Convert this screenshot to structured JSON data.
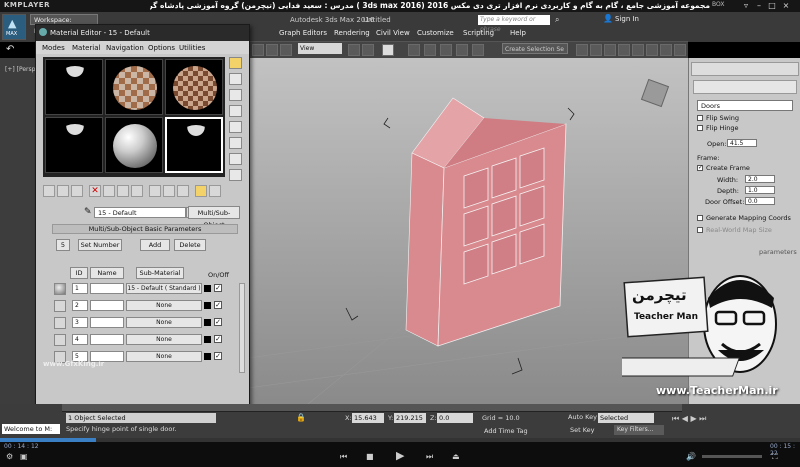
{
  "player": {
    "logo": "KMPLAYER",
    "title": "مجموعه آموزشی جامع ، گام به گام و کاربردی نرم افزار تری دی مکس 2016 (3ds max 2016 ) مدرس : سعید فدایی (تیچرمن) گروه آموزشی پادشاه گرافیست ها",
    "box_label": "BOX",
    "time_current": "00 : 14 : 12",
    "time_total": "00 : 15 : 22",
    "progress": 0.12
  },
  "max": {
    "logo_label": "MAX",
    "workspace": "Workspace: Default",
    "app_title": "Autodesk 3ds Max 2016",
    "file_title": "Untitled",
    "search_placeholder": "Type a keyword or phrase",
    "sign_in": "Sign In",
    "menus": [
      "Graph Editors",
      "Rendering",
      "Civil View",
      "Customize",
      "Scripting",
      "Help"
    ],
    "view_dropdown": "View",
    "selection_set": "Create Selection Se",
    "viewport_label": "[+] [Perspective] [Realistic]"
  },
  "material_editor": {
    "title": "Material Editor - 15 - Default",
    "menus": [
      "Modes",
      "Material",
      "Navigation",
      "Options",
      "Utilities"
    ],
    "material_name": "15 - Default",
    "material_type": "Multi/Sub-Object",
    "rollout_title": "Multi/Sub-Object Basic Parameters",
    "num_value": "5",
    "set_number": "Set Number",
    "add": "Add",
    "delete": "Delete",
    "col_id": "ID",
    "col_name": "Name",
    "col_submaterial": "Sub-Material",
    "col_onoff": "On/Off",
    "rows": [
      {
        "id": "1",
        "material": "15 - Default  ( Standard )"
      },
      {
        "id": "2",
        "material": "None"
      },
      {
        "id": "3",
        "material": "None"
      },
      {
        "id": "4",
        "material": "None"
      },
      {
        "id": "5",
        "material": "None"
      }
    ]
  },
  "command_panel": {
    "object_type": "Doors",
    "flip_swing": "Flip Swing",
    "flip_hinge": "Flip Hinge",
    "open_label": "Open:",
    "open_value": "41.5",
    "frame_label": "Frame:",
    "create_frame": "Create Frame",
    "width_label": "Width:",
    "width_value": "2.0",
    "depth_label": "Depth:",
    "depth_value": "1.0",
    "door_offset_label": "Door Offset:",
    "door_offset_value": "0.0",
    "gen_mapping": "Generate Mapping Coords",
    "real_world": "Real-World Map Size",
    "parameters_label": "parameters"
  },
  "status": {
    "objects_selected": "1 Object Selected",
    "prompt": "Specify hinge point of single door.",
    "x_label": "X:",
    "x_value": "15.643",
    "y_label": "Y:",
    "y_value": "219.215",
    "z_label": "Z:",
    "z_value": "0.0",
    "grid": "Grid = 10.0",
    "auto_key": "Auto Key",
    "selected": "Selected",
    "set_key": "Set Key",
    "key_filters": "Key Filters...",
    "add_time_tag": "Add Time Tag",
    "maxscript": "Welcome to M:"
  },
  "watermarks": {
    "teacherman_logo": "تیچرمن",
    "teacherman_caption": "Teacher Man",
    "teacherman_url": "www.TeacherMan.ir",
    "gfxking": "www.GfxKing.ir"
  },
  "colors": {
    "door": "#d88a8f",
    "door_dark": "#b86b72",
    "accent": "#f1c232"
  }
}
